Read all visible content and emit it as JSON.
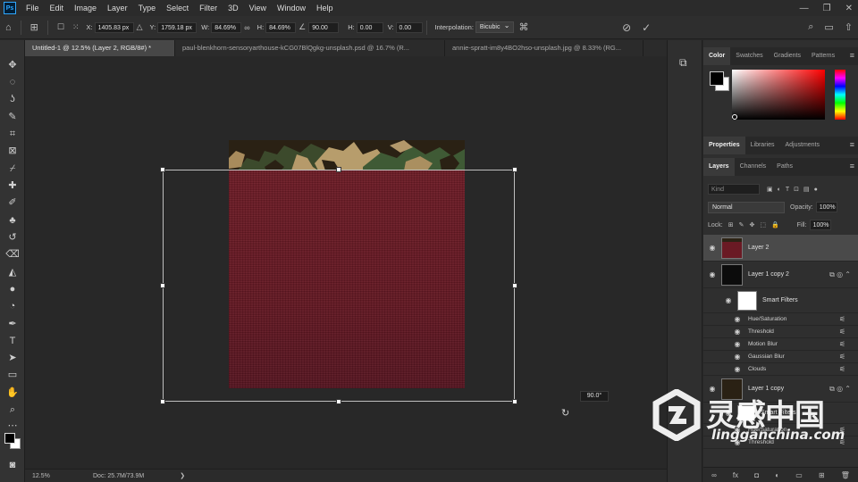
{
  "app": {
    "logo_text": "Ps"
  },
  "menu": [
    "File",
    "Edit",
    "Image",
    "Layer",
    "Type",
    "Select",
    "Filter",
    "3D",
    "View",
    "Window",
    "Help"
  ],
  "window_controls": {
    "minimize": "—",
    "restore": "❐",
    "close": "✕"
  },
  "options": {
    "x_label": "X:",
    "x_value": "1405.83 px",
    "y_label": "Y:",
    "y_value": "1759.18 px",
    "w_label": "W:",
    "w_value": "84.69%",
    "h_label": "H:",
    "h_value": "84.69%",
    "angle_value": "90.00",
    "hskew_label": "H:",
    "hskew_value": "0.00",
    "vskew_label": "V:",
    "vskew_value": "0.00",
    "interp_label": "Interpolation:",
    "interp_value": "Bicubic"
  },
  "tabs": [
    {
      "label": "Untitled-1 @ 12.5% (Layer 2, RGB/8#) *"
    },
    {
      "label": "paul-blenkhorn-sensoryarthouse-kCG07BlQgkg-unsplash.psd @ 16.7% (R..."
    },
    {
      "label": "annie-spratt-im8y4BO2hso-unsplash.jpg @ 8.33% (RG..."
    }
  ],
  "canvas": {
    "angle_readout": "90.0°"
  },
  "status": {
    "zoom": "12.5%",
    "doc_info": "Doc: 25.7M/73.9M",
    "arrow": "❯"
  },
  "color_panel": {
    "tabs": [
      "Color",
      "Swatches",
      "Gradients",
      "Patterns"
    ]
  },
  "props_panel": {
    "tabs": [
      "Properties",
      "Libraries",
      "Adjustments"
    ]
  },
  "layers_panel": {
    "tabs": [
      "Layers",
      "Channels",
      "Paths"
    ],
    "kind_placeholder": "Kind",
    "blend_mode": "Normal",
    "opacity_label": "Opacity:",
    "opacity_value": "100%",
    "lock_label": "Lock:",
    "fill_label": "Fill:",
    "fill_value": "100%",
    "layers": [
      {
        "name": "Layer 2"
      },
      {
        "name": "Layer 1 copy 2"
      },
      {
        "name": "Smart Filters"
      },
      {
        "name": "Hue/Saturation"
      },
      {
        "name": "Threshold"
      },
      {
        "name": "Motion Blur"
      },
      {
        "name": "Gaussian Blur"
      },
      {
        "name": "Clouds"
      },
      {
        "name": "Layer 1 copy"
      },
      {
        "name": "Smart Filters"
      },
      {
        "name": "Hue/Saturation"
      },
      {
        "name": "Threshold"
      }
    ]
  },
  "watermark": {
    "cn": "灵感中国",
    "url": "lingganchina.com"
  },
  "colors": {
    "accent": "#31a8ff",
    "fabric_red": "#6a1a24",
    "canvas_bg": "#282828"
  }
}
